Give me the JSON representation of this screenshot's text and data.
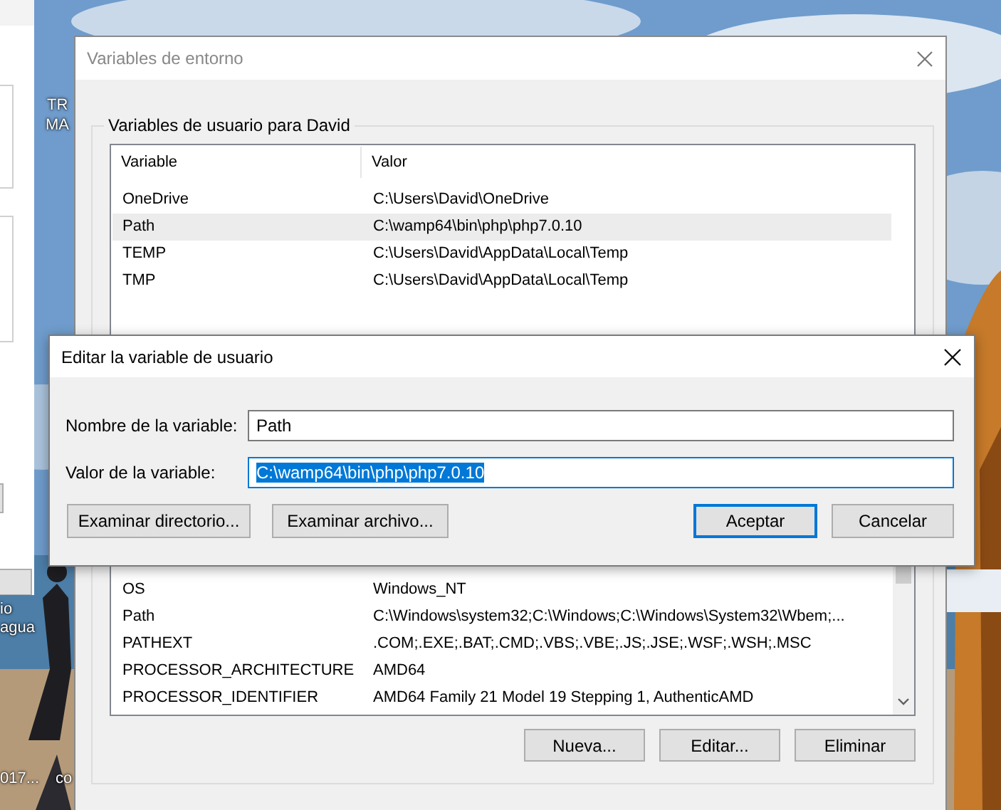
{
  "desktop": {
    "icon_labels": [
      {
        "text": "TR"
      },
      {
        "text": "MA"
      },
      {
        "text": "io"
      },
      {
        "text": "agua"
      },
      {
        "text": "017..."
      },
      {
        "text": "co"
      }
    ]
  },
  "env_window": {
    "title": "Variables de entorno",
    "active": false,
    "user_group": {
      "label": "Variables de usuario para David",
      "columns": [
        "Variable",
        "Valor"
      ],
      "rows": [
        {
          "variable": "OneDrive",
          "value": "C:\\Users\\David\\OneDrive",
          "selected": false
        },
        {
          "variable": "Path",
          "value": "C:\\wamp64\\bin\\php\\php7.0.10",
          "selected": true
        },
        {
          "variable": "TEMP",
          "value": "C:\\Users\\David\\AppData\\Local\\Temp",
          "selected": false
        },
        {
          "variable": "TMP",
          "value": "C:\\Users\\David\\AppData\\Local\\Temp",
          "selected": false
        }
      ]
    },
    "system_list": {
      "rows": [
        {
          "variable": "OS",
          "value": "Windows_NT"
        },
        {
          "variable": "Path",
          "value": "C:\\Windows\\system32;C:\\Windows;C:\\Windows\\System32\\Wbem;..."
        },
        {
          "variable": "PATHEXT",
          "value": ".COM;.EXE;.BAT;.CMD;.VBS;.VBE;.JS;.JSE;.WSF;.WSH;.MSC"
        },
        {
          "variable": "PROCESSOR_ARCHITECTURE",
          "value": "AMD64"
        },
        {
          "variable": "PROCESSOR_IDENTIFIER",
          "value": "AMD64 Family 21 Model 19 Stepping 1, AuthenticAMD"
        }
      ]
    },
    "buttons": [
      "Nueva...",
      "Editar...",
      "Eliminar"
    ]
  },
  "edit_dialog": {
    "title": "Editar la variable de usuario",
    "fields": [
      {
        "label": "Nombre de la variable:",
        "value": "Path",
        "focused": false
      },
      {
        "label": "Valor de la variable:",
        "value": "C:\\wamp64\\bin\\php\\php7.0.10",
        "focused": true
      }
    ],
    "buttons": [
      {
        "label": "Examinar directorio...",
        "default": false
      },
      {
        "label": "Examinar archivo...",
        "default": false
      },
      {
        "label": "Aceptar",
        "default": true
      },
      {
        "label": "Cancelar",
        "default": false
      }
    ]
  }
}
